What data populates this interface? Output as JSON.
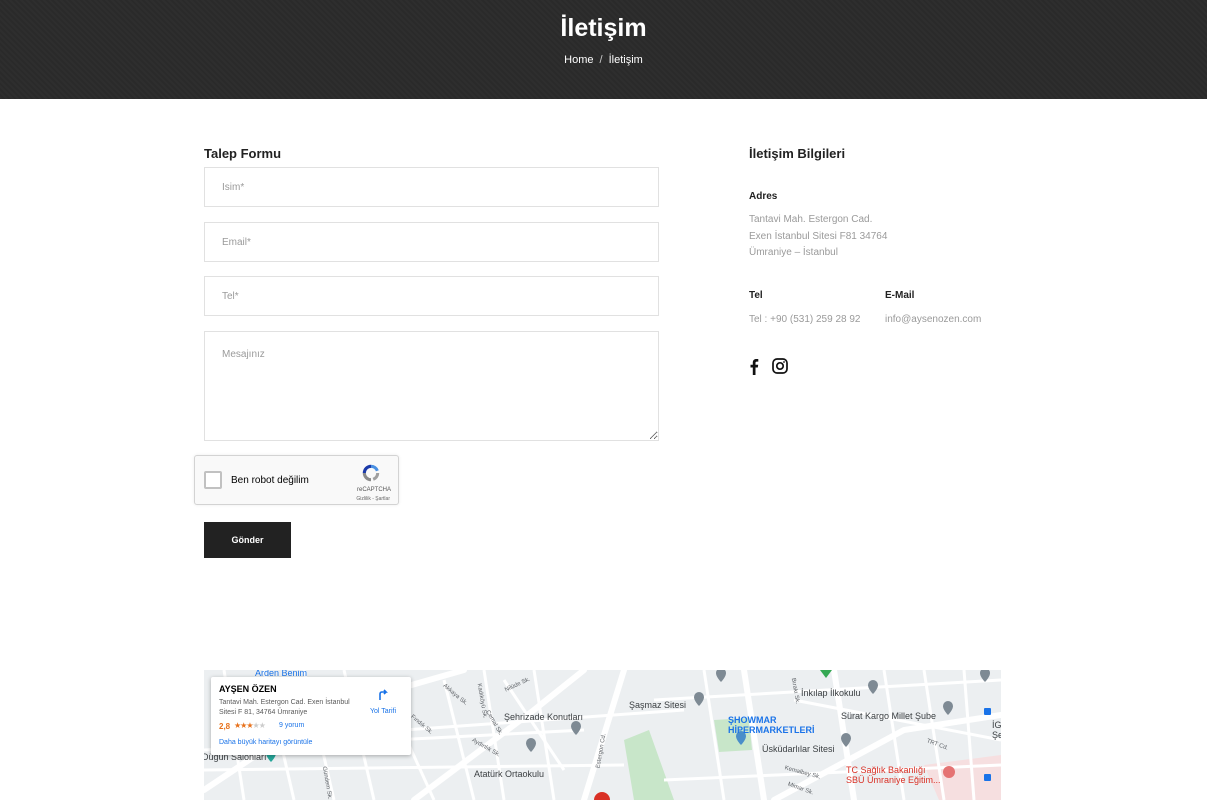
{
  "hero": {
    "title": "İletişim",
    "breadcrumb_home": "Home",
    "breadcrumb_sep": "/",
    "breadcrumb_current": "İletişim"
  },
  "form": {
    "title": "Talep Formu",
    "name_placeholder": "İsim*",
    "email_placeholder": "Email*",
    "phone_placeholder": "Tel*",
    "message_placeholder": "Mesajınız",
    "captcha_label": "Ben robot değilim",
    "captcha_brand": "reCAPTCHA",
    "captcha_terms": "Gizlilik - Şartlar",
    "submit_label": "Gönder"
  },
  "info": {
    "title": "İletişim Bilgileri",
    "address_label": "Adres",
    "address_line1": "Tantavi Mah. Estergon Cad.",
    "address_line2": "Exen İstanbul Sitesi F81 34764",
    "address_line3": "Ümraniye – İstanbul",
    "phone_label": "Tel",
    "phone_value": "Tel : +90 (531) 259 28 92",
    "email_label": "E-Mail",
    "email_value": "info@aysenozen.com",
    "social": [
      "facebook-icon",
      "instagram-icon"
    ]
  },
  "map": {
    "card": {
      "name": "AYŞEN ÖZEN",
      "address": "Tantavi Mah. Estergon Cad. Exen İstanbul Sitesi F 81, 34764 Ümraniye",
      "rating": "2,8",
      "stars_on": "★★★",
      "stars_off": "★★",
      "reviews": "9 yorum",
      "larger_map": "Daha büyük haritayı görüntüle",
      "directions": "Yol Tarifi"
    },
    "places": {
      "arden": "Arden Benim",
      "sehrizade": "Şehrizade Konutları",
      "sasmaz": "Şaşmaz Sitesi",
      "showmar1": "ŞHOWMAR",
      "showmar2": "HİPERMARKETLERİ",
      "uskudar": "Üsküdarlılar Sitesi",
      "inkilap": "İnkılap İlkokulu",
      "surat": "Sürat Kargo Millet Şube",
      "saglik1": "TC Sağlık Bakanlığı",
      "saglik2": "SBÜ Ümraniye Eğitim...",
      "ataturk": "Atatürk Ortaokulu",
      "salon": "Düğün Salonları",
      "ig": "İG",
      "se": "Şe"
    },
    "streets": [
      "Akkaya Sk.",
      "Nilüde Sk.",
      "Kadıköyü Sk.",
      "Fındık Sk.",
      "Cemal Sk.",
      "Aydınlık Sk.",
      "Estergon Cd.",
      "TRT Cd.",
      "Kemalbey Sk.",
      "Mimar Sk.",
      "Bırakı Sk.",
      "Gündem Sk."
    ],
    "colors": {
      "road": "#ffffff",
      "bg": "#eceff1",
      "park": "#c8e6c9",
      "pin_gray": "#7e8a94",
      "pin_blue": "#4a8ec9",
      "pin_red": "#d93025"
    }
  }
}
